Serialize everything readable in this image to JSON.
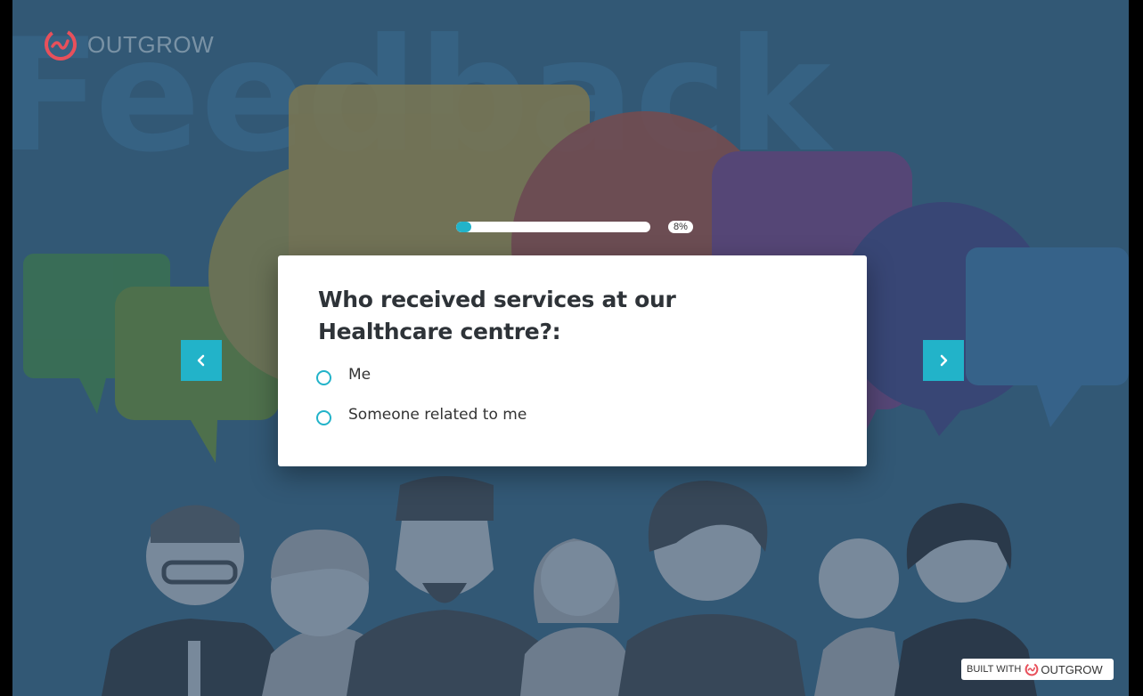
{
  "brand": {
    "name": "OUTGROW",
    "accent_color": "#22b3c9",
    "logo_color": "#e8505b",
    "logo_icon": "outgrow-logo-icon"
  },
  "background": {
    "watermark_text": "Feedback"
  },
  "progress": {
    "value_percent": 8,
    "label": "8%"
  },
  "navigation": {
    "prev_icon": "chevron-left-icon",
    "next_icon": "chevron-right-icon"
  },
  "question": {
    "text": "Who received services at our Healthcare centre?:",
    "options": [
      {
        "label": "Me"
      },
      {
        "label": "Someone related to me"
      }
    ]
  },
  "footer": {
    "built_with_label": "BUILT WITH",
    "brand_label": "OUTGROW"
  }
}
